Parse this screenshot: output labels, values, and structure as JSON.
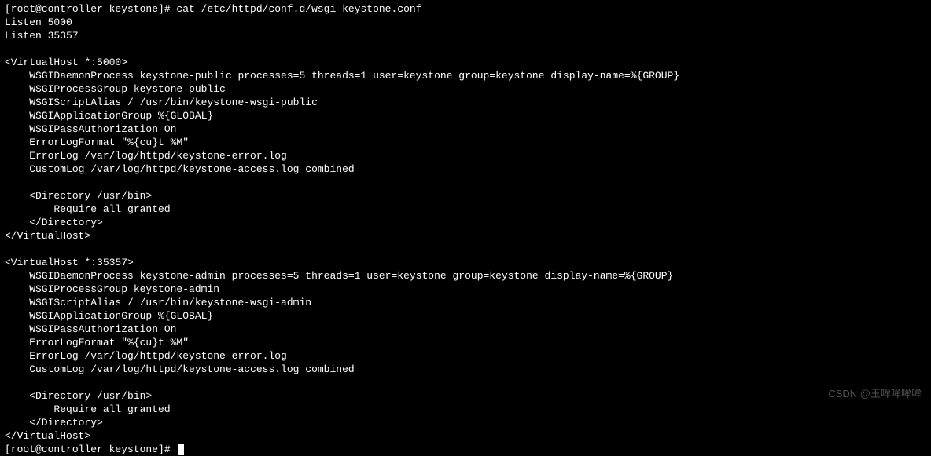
{
  "prompt1": {
    "full": "[root@controller keystone]# cat /etc/httpd/conf.d/wsgi-keystone.conf"
  },
  "output": {
    "lines": [
      "Listen 5000",
      "Listen 35357",
      "",
      "<VirtualHost *:5000>",
      "    WSGIDaemonProcess keystone-public processes=5 threads=1 user=keystone group=keystone display-name=%{GROUP}",
      "    WSGIProcessGroup keystone-public",
      "    WSGIScriptAlias / /usr/bin/keystone-wsgi-public",
      "    WSGIApplicationGroup %{GLOBAL}",
      "    WSGIPassAuthorization On",
      "    ErrorLogFormat \"%{cu}t %M\"",
      "    ErrorLog /var/log/httpd/keystone-error.log",
      "    CustomLog /var/log/httpd/keystone-access.log combined",
      "",
      "    <Directory /usr/bin>",
      "        Require all granted",
      "    </Directory>",
      "</VirtualHost>",
      "",
      "<VirtualHost *:35357>",
      "    WSGIDaemonProcess keystone-admin processes=5 threads=1 user=keystone group=keystone display-name=%{GROUP}",
      "    WSGIProcessGroup keystone-admin",
      "    WSGIScriptAlias / /usr/bin/keystone-wsgi-admin",
      "    WSGIApplicationGroup %{GLOBAL}",
      "    WSGIPassAuthorization On",
      "    ErrorLogFormat \"%{cu}t %M\"",
      "    ErrorLog /var/log/httpd/keystone-error.log",
      "    CustomLog /var/log/httpd/keystone-access.log combined",
      "",
      "    <Directory /usr/bin>",
      "        Require all granted",
      "    </Directory>",
      "</VirtualHost>"
    ]
  },
  "prompt2": {
    "full": "[root@controller keystone]# "
  },
  "watermark": "CSDN @玉哞哞哞哞"
}
